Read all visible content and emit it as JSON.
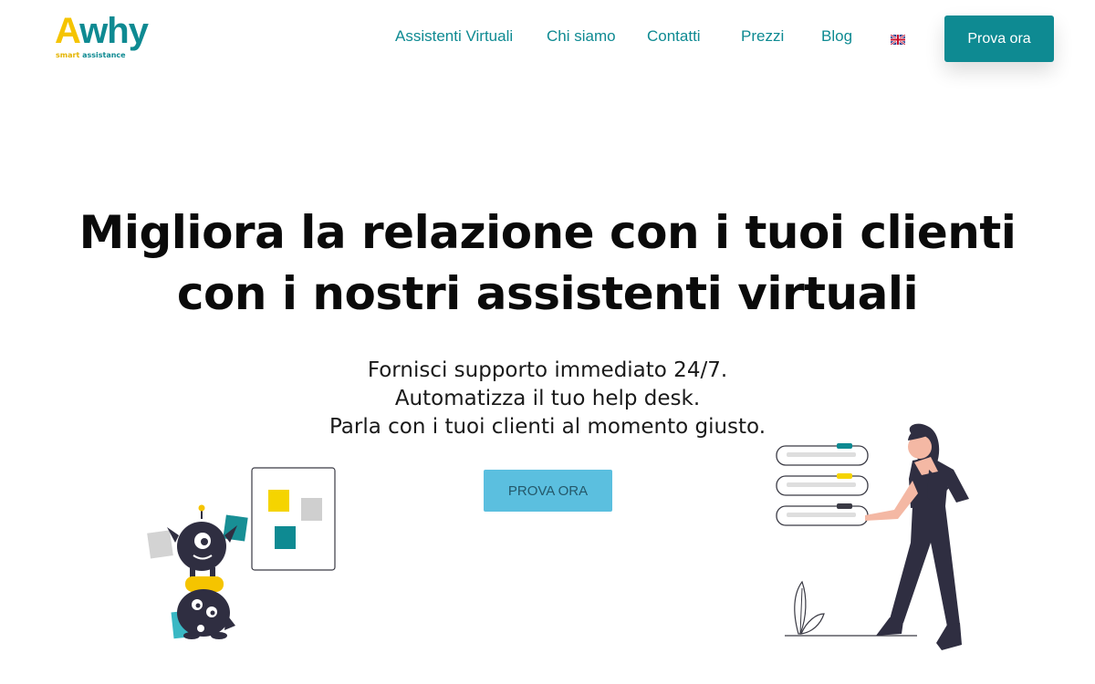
{
  "brand": {
    "logo_text": "Awhy",
    "logo_text_first": "A",
    "logo_text_rest": "why",
    "tagline_a": "smart",
    "tagline_b": "assistance",
    "colors": {
      "teal": "#0e8a92",
      "yellow": "#f5c400",
      "light_blue": "#5bbfdf"
    }
  },
  "nav": {
    "items": [
      "Assistenti Virtuali",
      "Chi siamo",
      "Contatti",
      "Prezzi",
      "Blog"
    ],
    "language_icon": "uk-flag-icon",
    "cta_label": "Prova ora"
  },
  "hero": {
    "title": "Migliora la relazione con i tuoi clienti con i nostri assistenti virtuali",
    "lines": [
      "Fornisci supporto immediato 24/7.",
      "Automatizza il tuo help desk.",
      "Parla con i tuoi clienti al momento giusto."
    ],
    "cta_label": "PROVA ORA"
  },
  "illustrations": {
    "left": "robots-with-sticky-notes-illustration",
    "right": "woman-with-checklist-illustration"
  }
}
